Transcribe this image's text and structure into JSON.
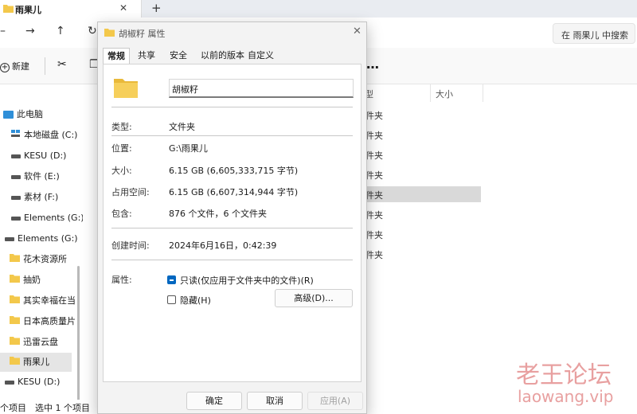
{
  "explorer": {
    "tab_title": "雨果儿",
    "search_placeholder": "在 雨果儿 中搜索",
    "new_label": "新建",
    "column_headers": [
      "型",
      "大小"
    ],
    "row_types": [
      "件夹",
      "件夹",
      "件夹",
      "件夹",
      "件夹",
      "件夹",
      "件夹",
      "件夹"
    ],
    "sidebar": [
      {
        "label": "此电脑",
        "icon": "computer-icon"
      },
      {
        "label": "本地磁盘 (C:)",
        "icon": "windows-drive-icon"
      },
      {
        "label": "KESU (D:)",
        "icon": "drive-icon"
      },
      {
        "label": "软件 (E:)",
        "icon": "drive-icon"
      },
      {
        "label": "素材 (F:)",
        "icon": "drive-icon"
      },
      {
        "label": "Elements (G:)",
        "icon": "drive-icon"
      },
      {
        "label": "Elements (G:)",
        "icon": "drive-icon"
      },
      {
        "label": "花木资源所",
        "icon": "folder-icon"
      },
      {
        "label": "抽奶",
        "icon": "folder-icon"
      },
      {
        "label": "其实幸福在当",
        "icon": "folder-icon"
      },
      {
        "label": "日本高质量片",
        "icon": "folder-icon"
      },
      {
        "label": "迅雷云盘",
        "icon": "folder-icon"
      },
      {
        "label": "雨果儿",
        "icon": "folder-icon"
      },
      {
        "label": "KESU (D:)",
        "icon": "drive-icon"
      }
    ],
    "status_items": "个项目",
    "status_selected": "选中 1 个项目"
  },
  "dialog": {
    "title": "胡椒籽 属性",
    "tabs": [
      "常规",
      "共享",
      "安全",
      "以前的版本",
      "自定义"
    ],
    "active_tab": "常规",
    "folder_name": "胡椒籽",
    "type_label": "类型:",
    "type_value": "文件夹",
    "location_label": "位置:",
    "location_value": "G:\\雨果儿",
    "size_label": "大小:",
    "size_value": "6.15 GB (6,605,333,715 字节)",
    "disk_size_label": "占用空间:",
    "disk_size_value": "6.15 GB (6,607,314,944 字节)",
    "contains_label": "包含:",
    "contains_value": "876 个文件，6 个文件夹",
    "created_label": "创建时间:",
    "created_value": "2024年6月16日，0:42:39",
    "attributes_label": "属性:",
    "readonly_label": "只读(仅应用于文件夹中的文件)(R)",
    "hidden_label": "隐藏(H)",
    "advanced_button": "高级(D)...",
    "ok_button": "确定",
    "cancel_button": "取消",
    "apply_button": "应用(A)"
  },
  "watermark": {
    "cn": "老王论坛",
    "en": "laowang.vip"
  },
  "colors": {
    "accent": "#0067c0",
    "folder": "#f3c84b",
    "watermark": "#e8a0a0"
  }
}
